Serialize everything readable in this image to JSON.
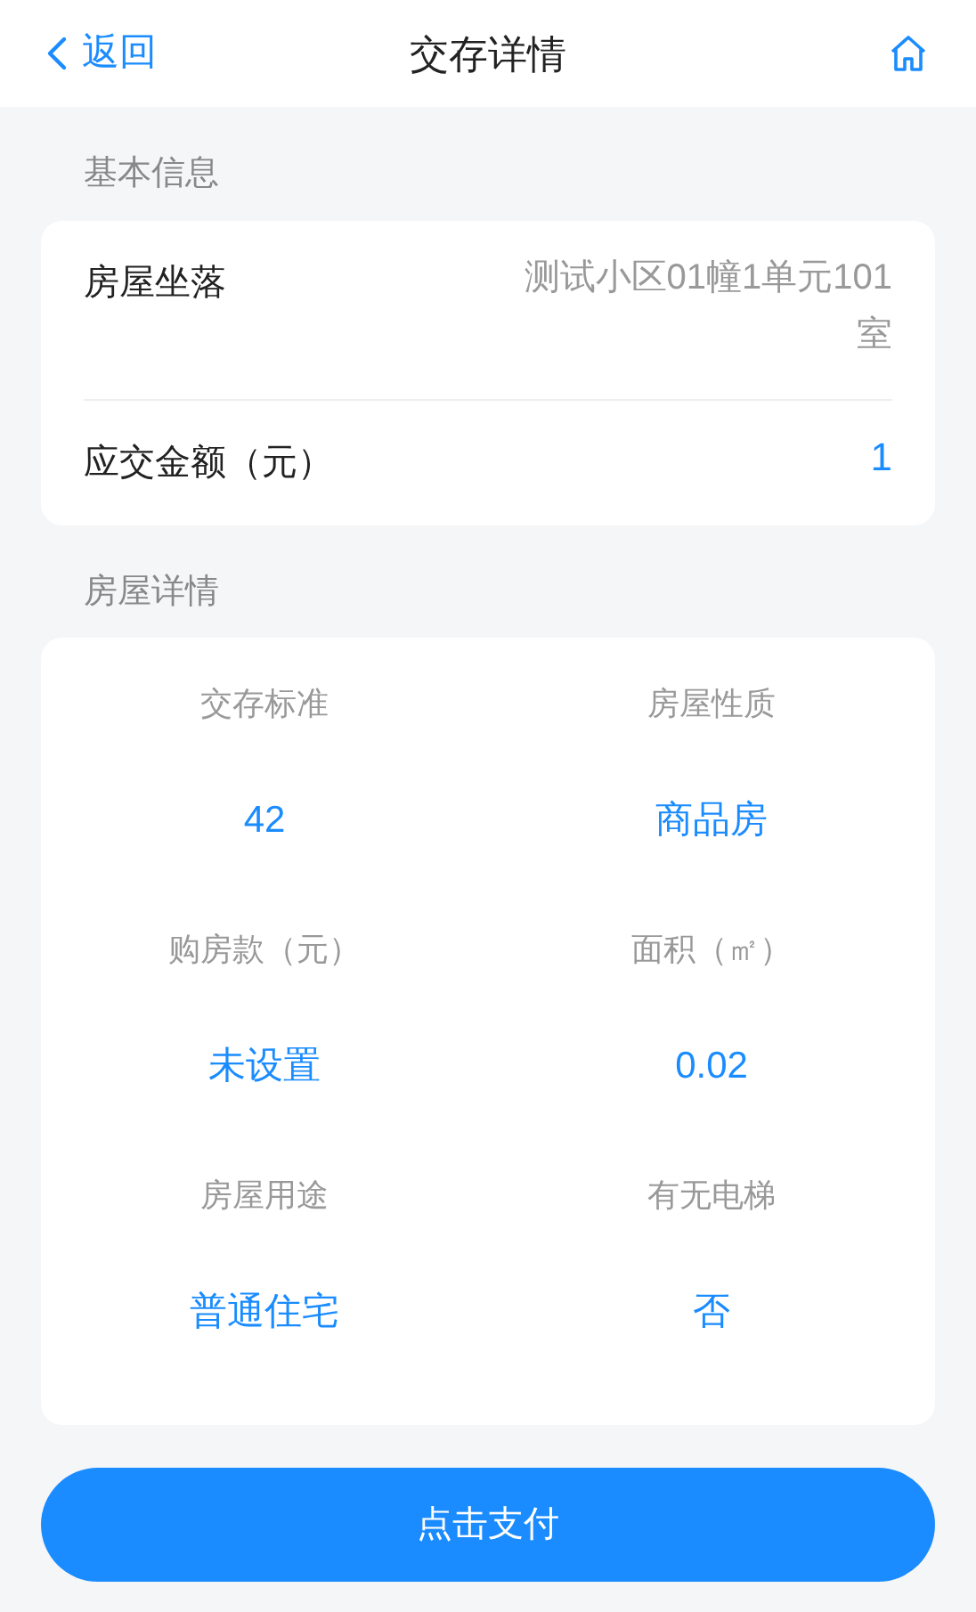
{
  "header": {
    "back": "返回",
    "title": "交存详情"
  },
  "basic": {
    "title": "基本信息",
    "rows": [
      {
        "label": "房屋坐落",
        "value": "测试小区01幢1单元101室",
        "kind": "muted"
      },
      {
        "label": "应交金额（元）",
        "value": "1",
        "kind": "accent"
      }
    ]
  },
  "details": {
    "title": "房屋详情",
    "items": [
      {
        "label": "交存标准",
        "value": "42"
      },
      {
        "label": "房屋性质",
        "value": "商品房"
      },
      {
        "label": "购房款（元）",
        "value": "未设置"
      },
      {
        "label": "面积（㎡）",
        "value": "0.02"
      },
      {
        "label": "房屋用途",
        "value": "普通住宅"
      },
      {
        "label": "有无电梯",
        "value": "否"
      }
    ]
  },
  "pay_button": "点击支付"
}
